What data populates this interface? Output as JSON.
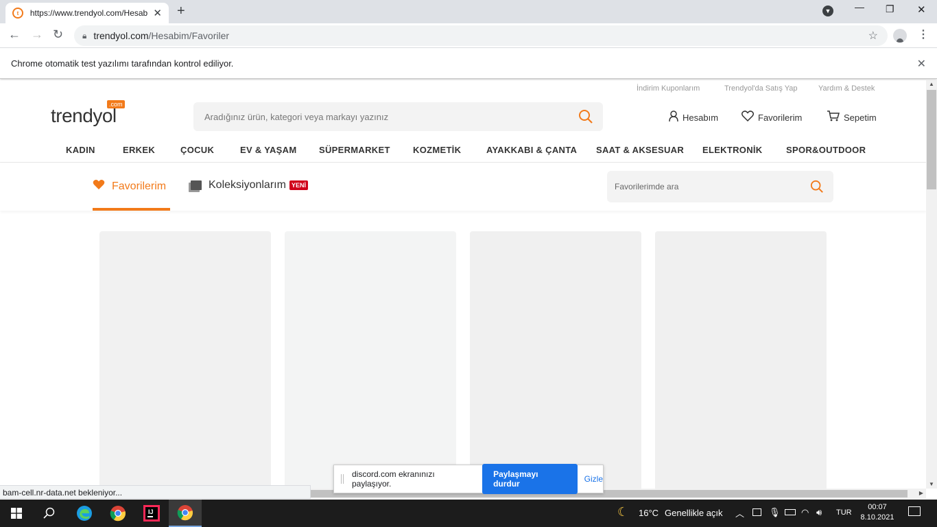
{
  "browser": {
    "tab_title": "https://www.trendyol.com/Hesab",
    "url_domain": "trendyol.com",
    "url_path": "/Hesabim/Favoriler",
    "infobar_text": "Chrome otomatik test yazılımı tarafından kontrol ediliyor.",
    "status_text": "bam-cell.nr-data.net bekleniyor..."
  },
  "site": {
    "logo_text": "trendyol",
    "logo_com": ".com",
    "top_links": [
      "İndirim Kuponlarım",
      "Trendyol'da Satış Yap",
      "Yardım & Destek"
    ],
    "search_placeholder": "Aradığınız ürün, kategori veya markayı yazınız",
    "user_links": {
      "account": "Hesabım",
      "favorites": "Favorilerim",
      "cart": "Sepetim"
    },
    "categories": [
      "KADIN",
      "ERKEK",
      "ÇOCUK",
      "EV & YAŞAM",
      "SÜPERMARKET",
      "KOZMETİK",
      "AYAKKABI & ÇANTA",
      "SAAT & AKSESUAR",
      "ELEKTRONİK",
      "SPOR&OUTDOOR"
    ],
    "brand_color": "#f27a1a"
  },
  "favorites": {
    "tab_favorites": "Favorilerim",
    "tab_collections": "Koleksiyonlarım",
    "new_badge": "YENİ",
    "search_placeholder": "Favorilerimde ara"
  },
  "share_bar": {
    "text": "discord.com ekranınızı paylaşıyor.",
    "stop_button": "Paylaşmayı durdur",
    "hide_link": "Gizle"
  },
  "taskbar": {
    "weather_temp": "16°C",
    "weather_desc": "Genellikle açık",
    "language": "TUR",
    "time": "00:07",
    "date": "8.10.2021"
  }
}
